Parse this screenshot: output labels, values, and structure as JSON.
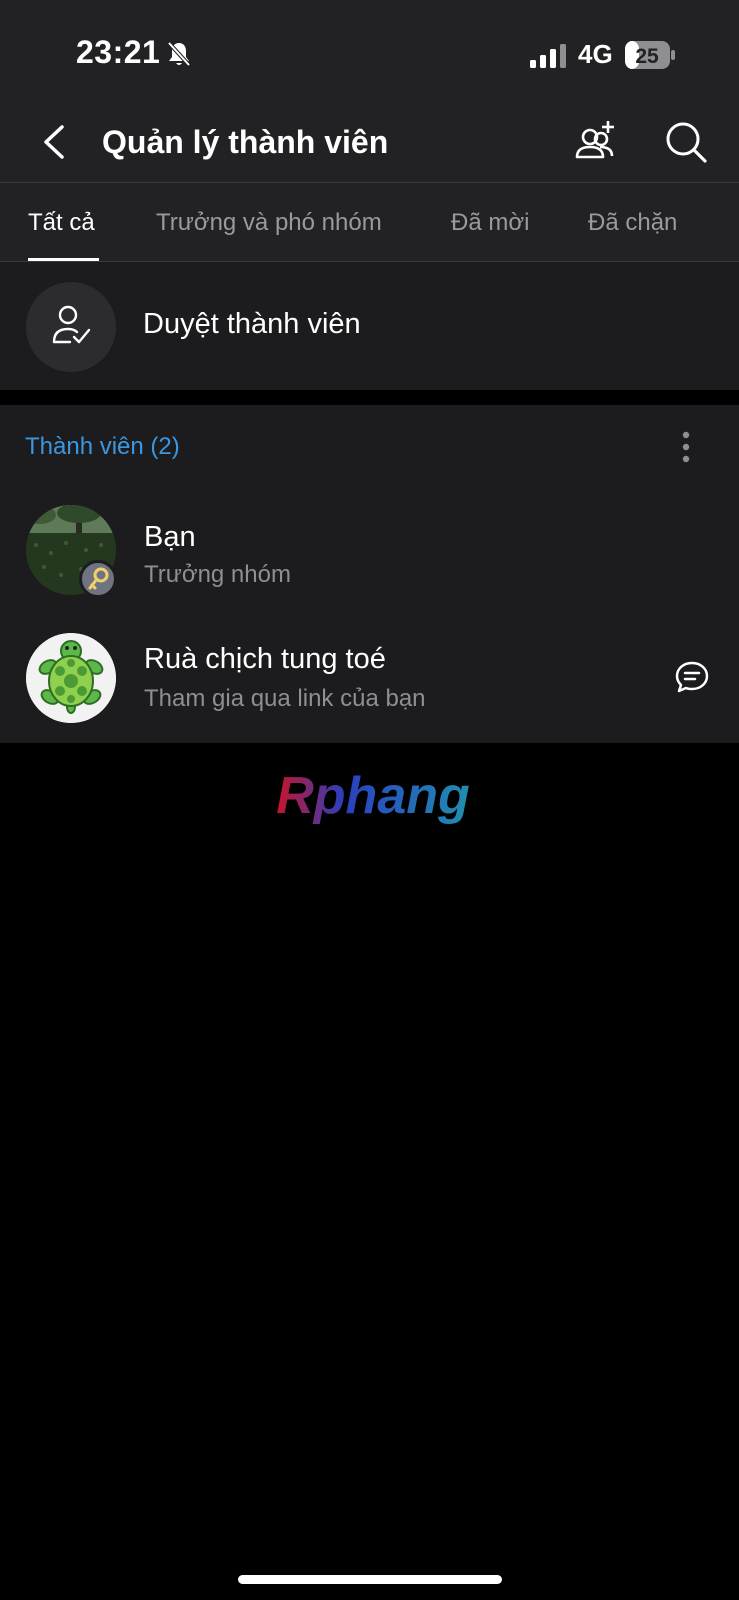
{
  "status_bar": {
    "time": "23:21",
    "network": "4G",
    "battery": "25"
  },
  "header": {
    "title": "Quản lý thành viên"
  },
  "tabs": [
    {
      "label": "Tất cả"
    },
    {
      "label": "Trưởng và phó nhóm"
    },
    {
      "label": "Đã mời"
    },
    {
      "label": "Đã chặn"
    }
  ],
  "approve": {
    "label": "Duyệt thành viên"
  },
  "members_section": {
    "title": "Thành viên (2)",
    "items": [
      {
        "name": "Bạn",
        "subtitle": "Trưởng nhóm"
      },
      {
        "name": "Ruà chịch tung toé",
        "subtitle": "Tham gia qua link của bạn"
      }
    ]
  },
  "watermark": {
    "text": "Rphang"
  },
  "colors": {
    "accent": "#3c97e0",
    "background": "#000000",
    "surface": "#1c1c1e",
    "header": "#222224"
  }
}
